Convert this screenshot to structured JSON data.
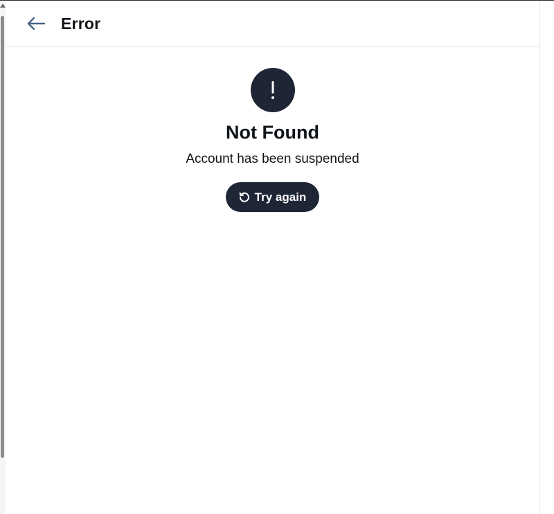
{
  "header": {
    "back_icon": "arrow-left-icon",
    "title": "Error"
  },
  "error": {
    "icon": "exclamation-icon",
    "title": "Not Found",
    "message": "Account has been suspended",
    "retry_icon": "refresh-icon",
    "retry_label": "Try again"
  },
  "colors": {
    "accent_dark": "#1e2535",
    "back_arrow": "#4a6285",
    "text": "#0f1419"
  }
}
